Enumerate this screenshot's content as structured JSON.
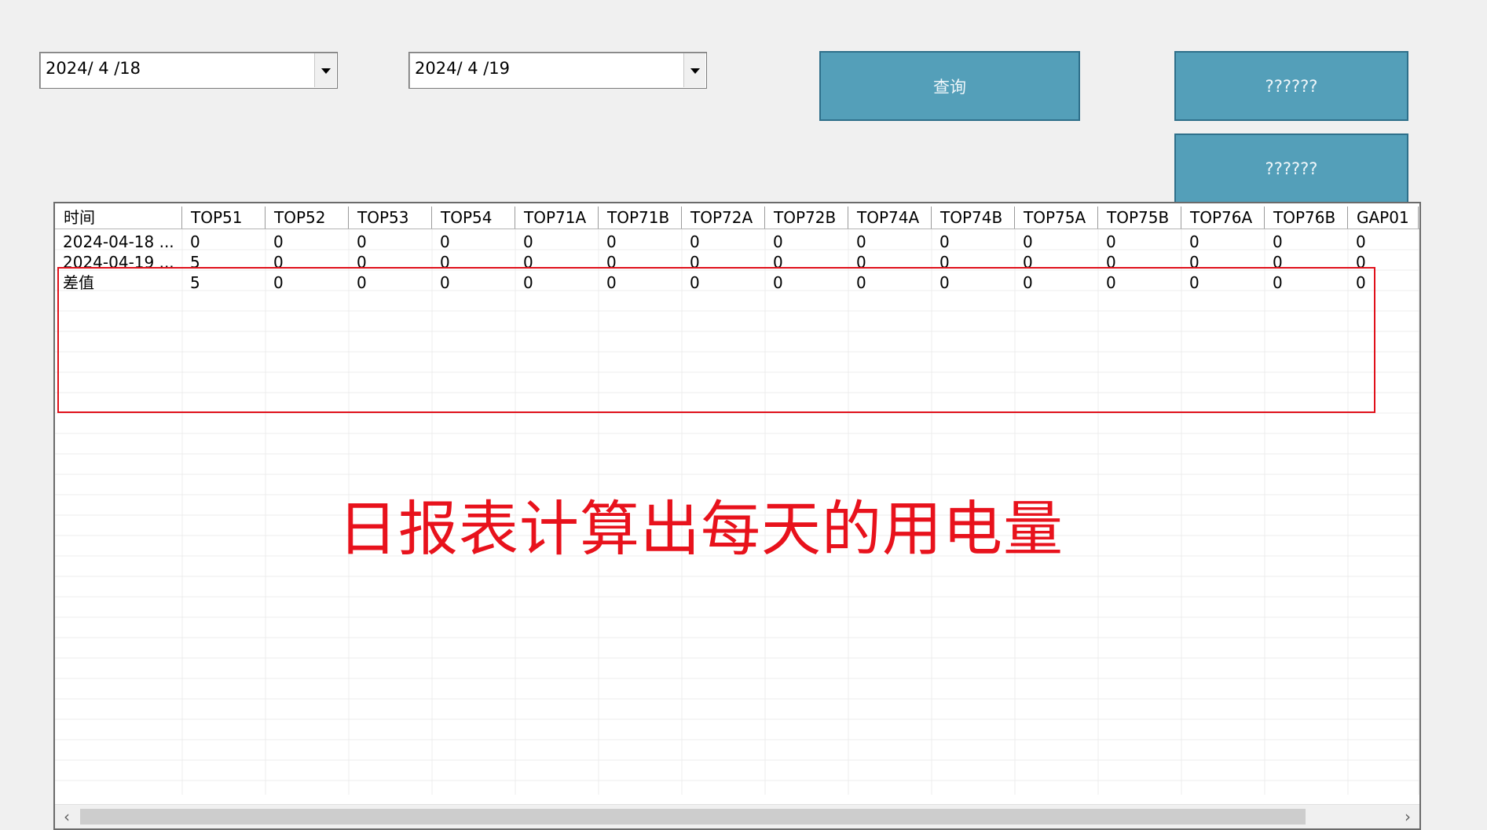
{
  "filters": {
    "start_date": "2024/ 4 /18",
    "end_date": "2024/ 4 /19",
    "dropdown_icon": "chevron-down-icon"
  },
  "buttons": {
    "query": "查询",
    "button2": "??????",
    "button3": "??????"
  },
  "grid": {
    "columns": [
      "时间",
      "TOP51",
      "TOP52",
      "TOP53",
      "TOP54",
      "TOP71A",
      "TOP71B",
      "TOP72A",
      "TOP72B",
      "TOP74A",
      "TOP74B",
      "TOP75A",
      "TOP75B",
      "TOP76A",
      "TOP76B",
      "GAP01"
    ],
    "rows": [
      [
        "2024-04-18 ...",
        "0",
        "0",
        "0",
        "0",
        "0",
        "0",
        "0",
        "0",
        "0",
        "0",
        "0",
        "0",
        "0",
        "0",
        "0"
      ],
      [
        "2024-04-19 ...",
        "5",
        "0",
        "0",
        "0",
        "0",
        "0",
        "0",
        "0",
        "0",
        "0",
        "0",
        "0",
        "0",
        "0",
        "0"
      ],
      [
        "差值",
        "5",
        "0",
        "0",
        "0",
        "0",
        "0",
        "0",
        "0",
        "0",
        "0",
        "0",
        "0",
        "0",
        "0",
        "0"
      ]
    ]
  },
  "annotation": {
    "text": "日报表计算出每天的用电量",
    "color": "#e8121c"
  },
  "colors": {
    "button_bg": "#549fb9",
    "highlight": "#e0101a"
  }
}
